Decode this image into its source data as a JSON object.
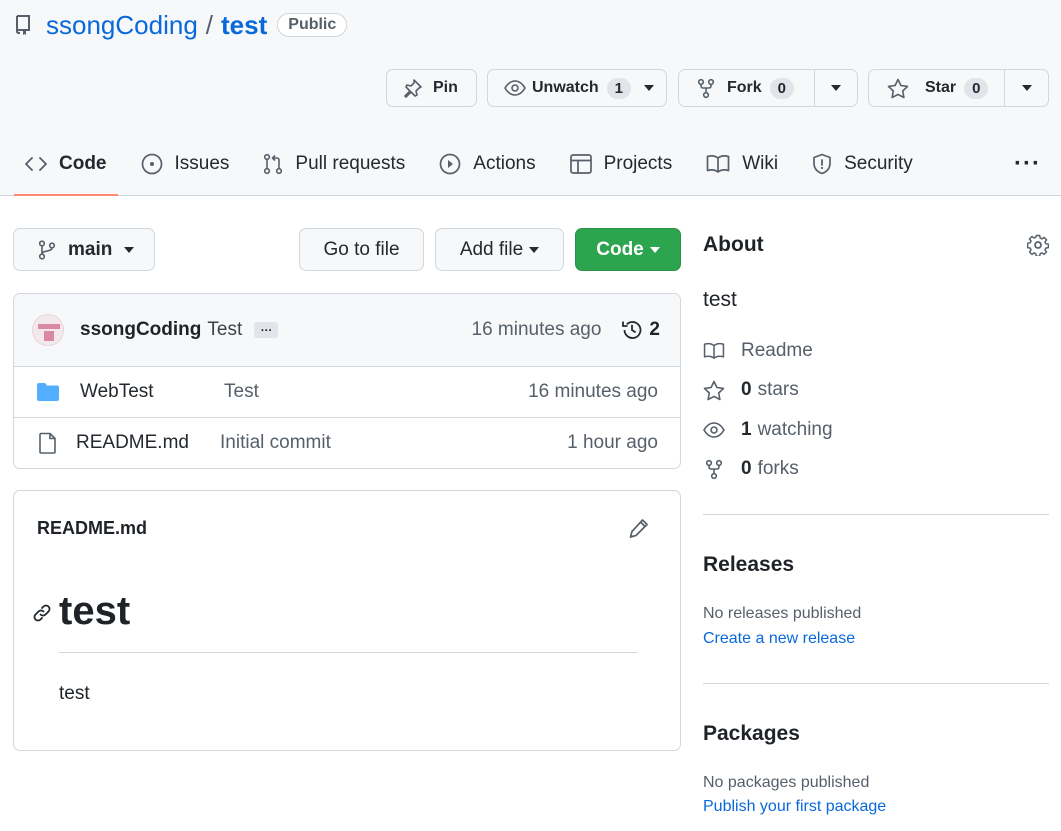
{
  "repo": {
    "owner": "ssongCoding",
    "separator": "/",
    "name": "test",
    "visibility": "Public"
  },
  "actions": {
    "pin": "Pin",
    "unwatch": "Unwatch",
    "watch_count": "1",
    "fork": "Fork",
    "fork_count": "0",
    "star": "Star",
    "star_count": "0"
  },
  "nav": {
    "tabs": [
      {
        "label": "Code",
        "icon": "code-icon",
        "active": true
      },
      {
        "label": "Issues",
        "icon": "issue-icon"
      },
      {
        "label": "Pull requests",
        "icon": "pull-request-icon"
      },
      {
        "label": "Actions",
        "icon": "play-icon"
      },
      {
        "label": "Projects",
        "icon": "table-icon"
      },
      {
        "label": "Wiki",
        "icon": "book-icon"
      },
      {
        "label": "Security",
        "icon": "shield-icon"
      }
    ],
    "more": "···"
  },
  "toolbar": {
    "branch": "main",
    "go_to_file": "Go to file",
    "add_file": "Add file",
    "code": "Code"
  },
  "commit": {
    "author": "ssongCoding",
    "message": "Test",
    "ellipsis": "…",
    "time": "16 minutes ago",
    "history_count": "2"
  },
  "files": [
    {
      "type": "folder",
      "name": "WebTest",
      "message": "Test",
      "time": "16 minutes ago"
    },
    {
      "type": "file",
      "name": "README.md",
      "message": "Initial commit",
      "time": "1 hour ago"
    }
  ],
  "readme": {
    "filename": "README.md",
    "heading": "test",
    "body": "test"
  },
  "sidebar": {
    "about_title": "About",
    "description": "test",
    "readme_label": "Readme",
    "stars_count": "0",
    "stars_label": "stars",
    "watching_count": "1",
    "watching_label": "watching",
    "forks_count": "0",
    "forks_label": "forks",
    "releases_title": "Releases",
    "releases_note": "No releases published",
    "releases_link": "Create a new release",
    "packages_title": "Packages",
    "packages_note": "No packages published",
    "packages_link": "Publish your first package"
  },
  "colors": {
    "link": "#0969da",
    "code_button": "#2da44e",
    "active_tab_underline": "#fd8c73"
  }
}
